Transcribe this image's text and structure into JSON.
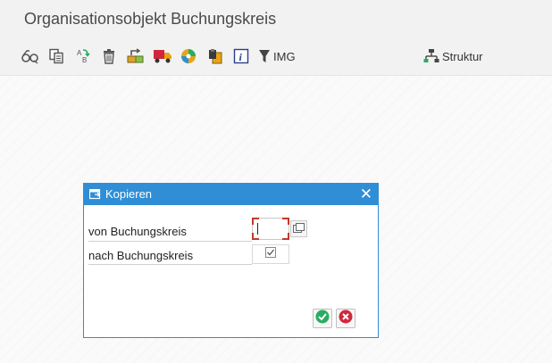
{
  "window": {
    "title": "Organisationsobjekt Buchungskreis"
  },
  "toolbar": {
    "items": [
      {
        "icon": "glasses-display-icon"
      },
      {
        "icon": "copy-icon"
      },
      {
        "icon": "rename-ab-icon"
      },
      {
        "icon": "delete-trash-icon"
      },
      {
        "icon": "transport-icon"
      },
      {
        "icon": "truck-icon"
      },
      {
        "icon": "cd-disc-icon"
      },
      {
        "icon": "clipboard-icon"
      },
      {
        "icon": "info-icon"
      },
      {
        "icon": "funnel-icon",
        "label": "IMG"
      },
      {
        "icon": "structure-hierarchy-icon",
        "label": "Struktur"
      }
    ]
  },
  "dialog": {
    "title": "Kopieren",
    "close_symbol": "✕",
    "fields": {
      "from_label": "von  Buchungskreis",
      "from_value": "",
      "to_label": "nach Buchungskreis"
    },
    "buttons": {
      "confirm": "confirm-check-icon",
      "cancel": "cancel-x-icon"
    }
  },
  "colors": {
    "accent": "#2f8ed6",
    "confirm": "#27ae60",
    "cancel": "#d0283a"
  }
}
